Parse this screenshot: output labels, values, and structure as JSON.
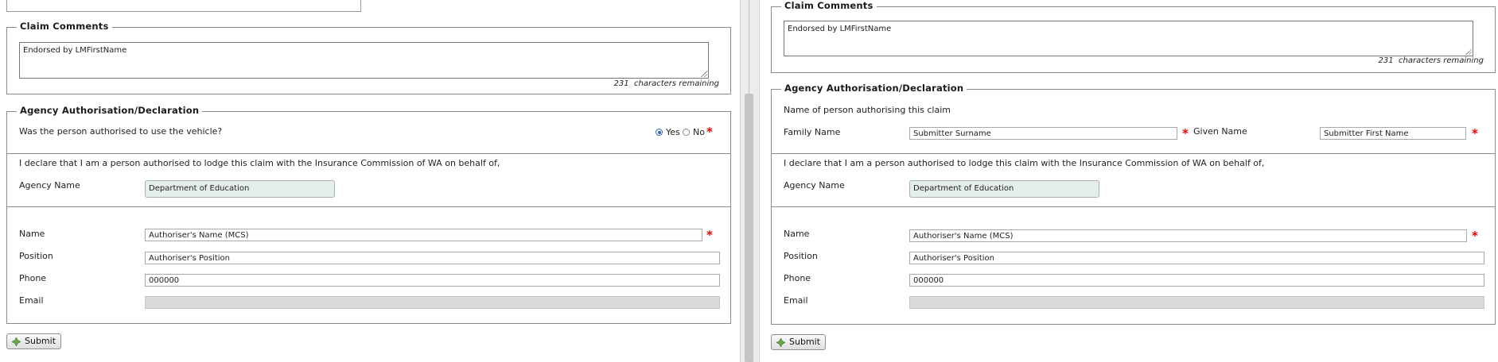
{
  "colors": {
    "required": "#e00000",
    "agency_bg": "#e5efe9",
    "disabled_bg": "#d9d9d9"
  },
  "left": {
    "claim_comments": {
      "legend": "Claim Comments",
      "value": "Endorsed by LMFirstName",
      "remaining_count": "231",
      "remaining_text": "characters remaining"
    },
    "authorisation": {
      "legend": "Agency Authorisation/Declaration",
      "question": "Was the person authorised to use the vehicle?",
      "yes_label": "Yes",
      "no_label": "No",
      "selected": "Yes",
      "declaration": "I declare that I am a person authorised to lodge this claim with the Insurance Commission of WA on behalf of,",
      "agency_label": "Agency Name",
      "agency_value": "Department of Education",
      "name_label": "Name",
      "name_value": "Authoriser's Name (MCS)",
      "position_label": "Position",
      "position_value": "Authoriser's Position",
      "phone_label": "Phone",
      "phone_value": "000000",
      "email_label": "Email",
      "email_value": ""
    },
    "submit_label": "Submit"
  },
  "right": {
    "claim_comments": {
      "legend": "Claim Comments",
      "value": "Endorsed by LMFirstName",
      "remaining_count": "231",
      "remaining_text": "characters remaining"
    },
    "authorisation": {
      "legend": "Agency Authorisation/Declaration",
      "person_heading": "Name of person authorising this claim",
      "family_label": "Family Name",
      "family_value": "Submitter Surname",
      "given_label": "Given Name",
      "given_value": "Submitter First Name",
      "declaration": "I declare that I am a person authorised to lodge this claim with the Insurance Commission of WA on behalf of,",
      "agency_label": "Agency Name",
      "agency_value": "Department of Education",
      "name_label": "Name",
      "name_value": "Authoriser's Name (MCS)",
      "position_label": "Position",
      "position_value": "Authoriser's Position",
      "phone_label": "Phone",
      "phone_value": "000000",
      "email_label": "Email",
      "email_value": ""
    },
    "submit_label": "Submit"
  }
}
